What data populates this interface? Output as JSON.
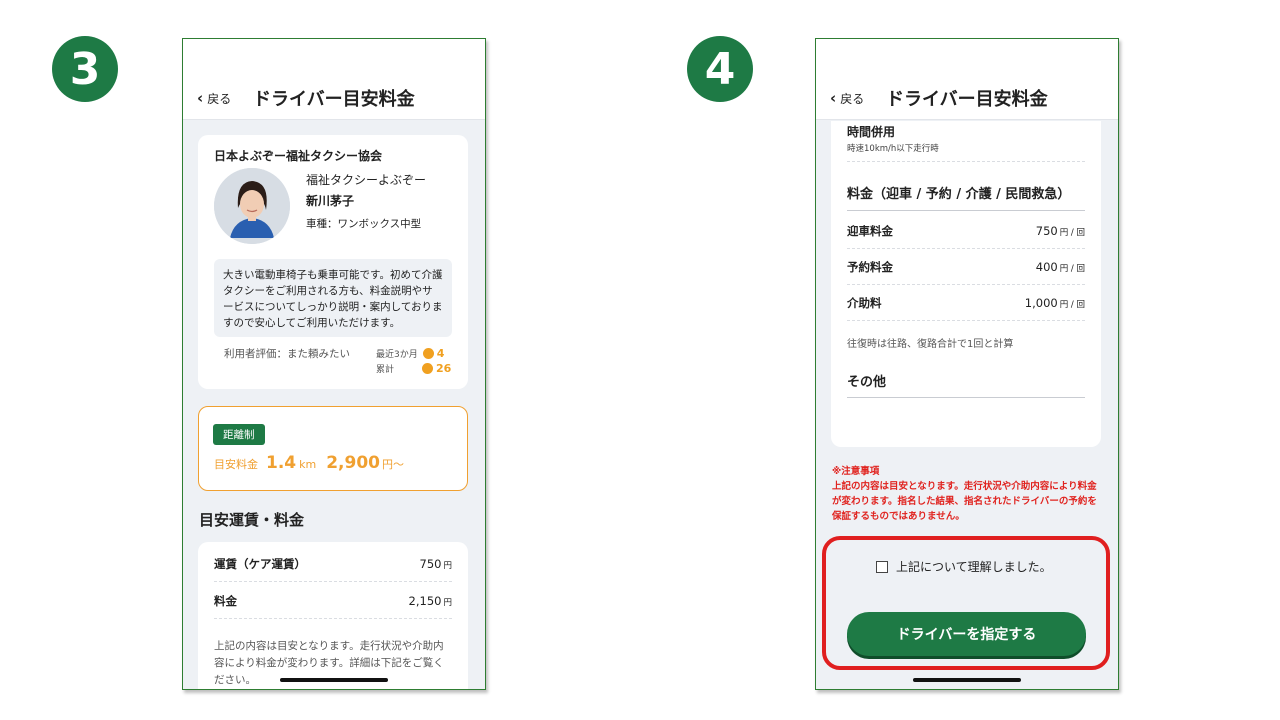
{
  "steps": {
    "left": "3",
    "right": "4"
  },
  "header": {
    "back_label": "戻る",
    "title": "ドライバー目安料金"
  },
  "profile": {
    "organization": "日本よぶぞー福祉タクシー協会",
    "company": "福祉タクシーよぶぞー",
    "driver_name": "新川茅子",
    "vehicle": "車種：ワンボックス中型",
    "intro": "大きい電動車椅子も乗車可能です。初めて介護タクシーをご利用される方も、料金説明やサービスについてしっかり説明・案内しておりますので安心してご利用いただけます。",
    "rating_label": "利用者評価：また頼みたい",
    "recent_label": "最近3か月",
    "recent_count": "4",
    "total_label": "累計",
    "total_count": "26"
  },
  "fare": {
    "badge": "距離制",
    "label": "目安料金",
    "distance": "1.4",
    "distance_unit": "km",
    "price": "2,900",
    "price_unit": "円～"
  },
  "estimate": {
    "section_title": "目安運賃・料金",
    "rows": [
      {
        "name": "運賃（ケア運賃）",
        "value": "750",
        "unit": "円"
      },
      {
        "name": "料金",
        "value": "2,150",
        "unit": "円"
      }
    ],
    "note": "上記の内容は目安となります。走行状況や介助内容により料金が変わります。詳細は下記をご覧ください。"
  },
  "detail": {
    "time_title": "時間併用",
    "time_sub": "時速10km/h以下走行時",
    "fee_heading": "料金（迎車 / 予約 / 介護 / 民間救急）",
    "rows": [
      {
        "name": "迎車料金",
        "value": "750",
        "unit": "円 / 回"
      },
      {
        "name": "予約料金",
        "value": "400",
        "unit": "円 / 回"
      },
      {
        "name": "介助料",
        "value": "1,000",
        "unit": "円 / 回"
      }
    ],
    "round_trip_note": "往復時は往路、復路合計で1回と計算",
    "other_heading": "その他"
  },
  "warning": {
    "title": "※注意事項",
    "body": "上記の内容は目安となります。走行状況や介助内容により料金が変わります。指名した結果、指名されたドライバーの予約を保証するものではありません。"
  },
  "confirm": {
    "checkbox_label": "上記について理解しました。",
    "button_label": "ドライバーを指定する"
  },
  "colors": {
    "brand": "#1e7a45",
    "accent": "#f0a030",
    "warning": "#e0231f"
  }
}
